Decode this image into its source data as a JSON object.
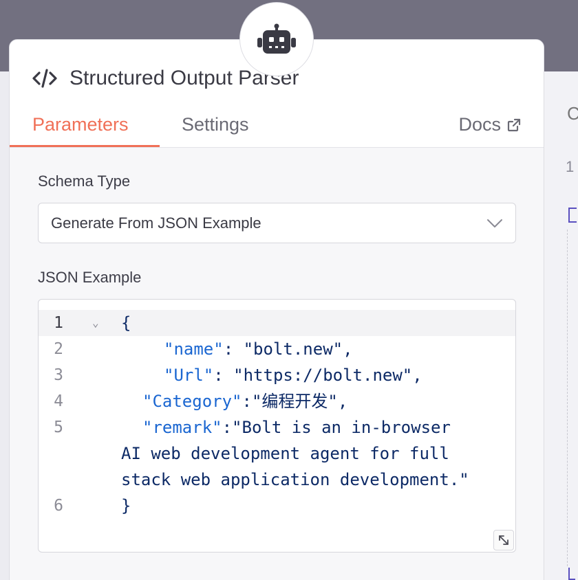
{
  "panel": {
    "title": "Structured Output Parser",
    "icon": "code-icon"
  },
  "tabs": [
    {
      "label": "Parameters",
      "active": true
    },
    {
      "label": "Settings",
      "active": false
    }
  ],
  "docs": {
    "label": "Docs",
    "icon": "external-link-icon"
  },
  "schema_type": {
    "label": "Schema Type",
    "value": "Generate From JSON Example"
  },
  "json_example": {
    "label": "JSON Example",
    "line_numbers": [
      "1",
      "2",
      "3",
      "4",
      "5",
      "6"
    ],
    "fold_icon": "⌄",
    "lines": [
      {
        "pre": "{",
        "key": "",
        "post": ""
      },
      {
        "pre": "",
        "key": "\"name\"",
        "post": ": \"bolt.new\","
      },
      {
        "pre": "",
        "key": "\"Url\"",
        "post": ": \"https://bolt.new\","
      },
      {
        "pre": "",
        "key": "\"Category\"",
        "post": ":\"编程开发\","
      },
      {
        "pre": "",
        "key": "\"remark\"",
        "post": ":\"Bolt is an in-browser"
      },
      {
        "pre": "AI web development agent for full",
        "key": "",
        "post": ""
      },
      {
        "pre": "stack web application development.\"",
        "key": "",
        "post": ""
      },
      {
        "pre": "}",
        "key": "",
        "post": ""
      }
    ]
  },
  "side_panel": {
    "letter": "C",
    "line_number": "1"
  },
  "colors": {
    "accent": "#f07057",
    "json_key": "#1a66d1",
    "json_value": "#0d2a66",
    "backdrop": "#727080"
  }
}
